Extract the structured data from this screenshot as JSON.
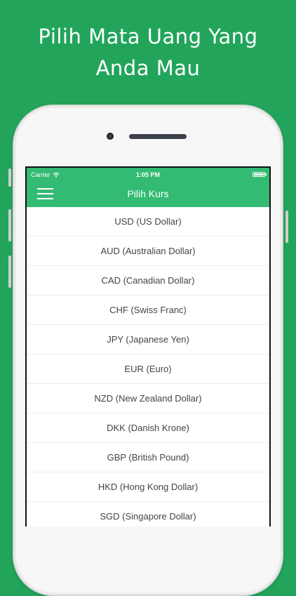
{
  "headline": {
    "line1": "Pilih Mata Uang Yang",
    "line2": "Anda Mau"
  },
  "status_bar": {
    "carrier": "Carrier",
    "time": "1:05 PM",
    "wifi_icon": "wifi-icon",
    "battery_icon": "battery-icon"
  },
  "nav": {
    "title": "Pilih Kurs",
    "menu_icon": "hamburger-menu-icon"
  },
  "colors": {
    "background": "#22a55b",
    "accent": "#33bb73",
    "text": "#444444"
  },
  "currencies": [
    "USD (US Dollar)",
    "AUD (Australian Dollar)",
    "CAD (Canadian Dollar)",
    "CHF (Swiss Franc)",
    "JPY (Japanese Yen)",
    "EUR (Euro)",
    "NZD (New Zealand Dollar)",
    "DKK (Danish Krone)",
    "GBP (British Pound)",
    "HKD (Hong Kong Dollar)",
    "SGD (Singapore Dollar)"
  ]
}
